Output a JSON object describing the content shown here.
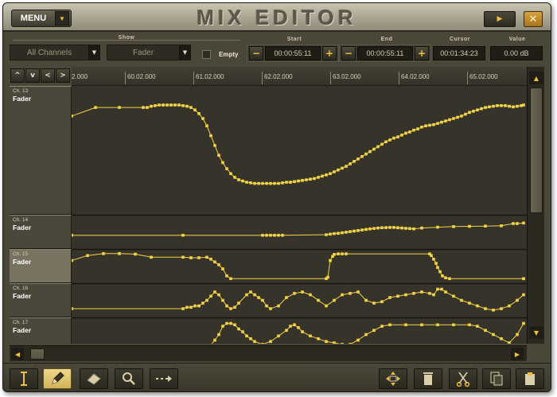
{
  "window": {
    "title": "MIX EDITOR"
  },
  "titlebar": {
    "menu_label": "MENU"
  },
  "controls": {
    "show_label": "Show",
    "channel_filter": "All Channels",
    "parameter_filter": "Fader",
    "empty_label": "Empty",
    "start_label": "Start",
    "start_value": "00:00:55:11",
    "end_label": "End",
    "end_value": "00:00:55:11",
    "cursor_label": "Cursor",
    "cursor_value": "00:01:34:23",
    "value_label": "Value",
    "value_value": "0.00 dB"
  },
  "ruler": {
    "ticks": [
      "2.000",
      "60.02.000",
      "61.02.000",
      "62.02.000",
      "63.02.000",
      "64.02.000",
      "65.02.000"
    ]
  },
  "lanes": [
    {
      "channel": "Ch. 13",
      "param": "Fader",
      "selected": false
    },
    {
      "channel": "Ch. 14",
      "param": "Fader",
      "selected": false
    },
    {
      "channel": "Ch. 15",
      "param": "Fader",
      "selected": true
    },
    {
      "channel": "Ch. 16",
      "param": "Fader",
      "selected": false
    },
    {
      "channel": "Ch. 17",
      "param": "Fader",
      "selected": false
    }
  ],
  "curves": [
    [
      [
        0,
        0.22
      ],
      [
        30,
        0.15
      ],
      [
        60,
        0.15
      ],
      [
        90,
        0.15
      ],
      [
        95,
        0.15
      ],
      [
        100,
        0.14
      ],
      [
        105,
        0.135
      ],
      [
        110,
        0.13
      ],
      [
        115,
        0.13
      ],
      [
        120,
        0.13
      ],
      [
        125,
        0.13
      ],
      [
        130,
        0.13
      ],
      [
        135,
        0.13
      ],
      [
        140,
        0.135
      ],
      [
        145,
        0.14
      ],
      [
        150,
        0.15
      ],
      [
        155,
        0.17
      ],
      [
        160,
        0.2
      ],
      [
        165,
        0.24
      ],
      [
        170,
        0.3
      ],
      [
        175,
        0.38
      ],
      [
        180,
        0.46
      ],
      [
        185,
        0.54
      ],
      [
        190,
        0.6
      ],
      [
        195,
        0.65
      ],
      [
        200,
        0.69
      ],
      [
        205,
        0.72
      ],
      [
        210,
        0.74
      ],
      [
        215,
        0.75
      ],
      [
        220,
        0.76
      ],
      [
        225,
        0.765
      ],
      [
        230,
        0.77
      ],
      [
        235,
        0.77
      ],
      [
        240,
        0.77
      ],
      [
        245,
        0.77
      ],
      [
        250,
        0.77
      ],
      [
        255,
        0.77
      ],
      [
        260,
        0.77
      ],
      [
        265,
        0.765
      ],
      [
        270,
        0.76
      ],
      [
        275,
        0.76
      ],
      [
        280,
        0.755
      ],
      [
        285,
        0.75
      ],
      [
        290,
        0.745
      ],
      [
        295,
        0.74
      ],
      [
        300,
        0.735
      ],
      [
        305,
        0.73
      ],
      [
        310,
        0.72
      ],
      [
        315,
        0.71
      ],
      [
        320,
        0.7
      ],
      [
        325,
        0.69
      ],
      [
        330,
        0.675
      ],
      [
        335,
        0.66
      ],
      [
        340,
        0.645
      ],
      [
        345,
        0.63
      ],
      [
        350,
        0.61
      ],
      [
        355,
        0.59
      ],
      [
        360,
        0.57
      ],
      [
        365,
        0.55
      ],
      [
        370,
        0.53
      ],
      [
        375,
        0.51
      ],
      [
        380,
        0.49
      ],
      [
        385,
        0.47
      ],
      [
        390,
        0.45
      ],
      [
        395,
        0.43
      ],
      [
        400,
        0.415
      ],
      [
        405,
        0.4
      ],
      [
        410,
        0.39
      ],
      [
        415,
        0.375
      ],
      [
        420,
        0.36
      ],
      [
        425,
        0.35
      ],
      [
        430,
        0.335
      ],
      [
        435,
        0.325
      ],
      [
        440,
        0.31
      ],
      [
        445,
        0.3
      ],
      [
        450,
        0.295
      ],
      [
        455,
        0.29
      ],
      [
        460,
        0.28
      ],
      [
        465,
        0.27
      ],
      [
        470,
        0.26
      ],
      [
        475,
        0.25
      ],
      [
        480,
        0.24
      ],
      [
        485,
        0.23
      ],
      [
        490,
        0.22
      ],
      [
        495,
        0.205
      ],
      [
        500,
        0.19
      ],
      [
        505,
        0.18
      ],
      [
        510,
        0.17
      ],
      [
        515,
        0.16
      ],
      [
        520,
        0.15
      ],
      [
        525,
        0.145
      ],
      [
        530,
        0.14
      ],
      [
        535,
        0.135
      ],
      [
        540,
        0.135
      ],
      [
        545,
        0.135
      ],
      [
        550,
        0.14
      ],
      [
        555,
        0.145
      ],
      [
        560,
        0.14
      ],
      [
        565,
        0.135
      ],
      [
        568,
        0.13
      ]
    ],
    [
      [
        0,
        0.62
      ],
      [
        140,
        0.62
      ],
      [
        240,
        0.62
      ],
      [
        245,
        0.62
      ],
      [
        250,
        0.62
      ],
      [
        255,
        0.62
      ],
      [
        260,
        0.62
      ],
      [
        265,
        0.62
      ],
      [
        320,
        0.6
      ],
      [
        325,
        0.58
      ],
      [
        330,
        0.56
      ],
      [
        335,
        0.55
      ],
      [
        340,
        0.53
      ],
      [
        345,
        0.51
      ],
      [
        350,
        0.49
      ],
      [
        355,
        0.47
      ],
      [
        360,
        0.45
      ],
      [
        365,
        0.43
      ],
      [
        370,
        0.41
      ],
      [
        375,
        0.39
      ],
      [
        380,
        0.375
      ],
      [
        385,
        0.36
      ],
      [
        390,
        0.35
      ],
      [
        395,
        0.345
      ],
      [
        400,
        0.34
      ],
      [
        405,
        0.34
      ],
      [
        410,
        0.35
      ],
      [
        415,
        0.36
      ],
      [
        420,
        0.37
      ],
      [
        425,
        0.38
      ],
      [
        430,
        0.39
      ],
      [
        440,
        0.36
      ],
      [
        460,
        0.33
      ],
      [
        480,
        0.31
      ],
      [
        500,
        0.3
      ],
      [
        520,
        0.29
      ],
      [
        540,
        0.28
      ],
      [
        555,
        0.2
      ],
      [
        560,
        0.2
      ],
      [
        568,
        0.18
      ]
    ],
    [
      [
        0,
        0.3
      ],
      [
        20,
        0.12
      ],
      [
        40,
        0.05
      ],
      [
        60,
        0.05
      ],
      [
        80,
        0.07
      ],
      [
        100,
        0.18
      ],
      [
        140,
        0.18
      ],
      [
        150,
        0.2
      ],
      [
        160,
        0.2
      ],
      [
        170,
        0.18
      ],
      [
        175,
        0.25
      ],
      [
        180,
        0.35
      ],
      [
        185,
        0.45
      ],
      [
        190,
        0.6
      ],
      [
        195,
        0.85
      ],
      [
        200,
        0.95
      ],
      [
        320,
        0.95
      ],
      [
        322,
        0.9
      ],
      [
        325,
        0.3
      ],
      [
        328,
        0.15
      ],
      [
        330,
        0.08
      ],
      [
        335,
        0.06
      ],
      [
        340,
        0.06
      ],
      [
        345,
        0.06
      ],
      [
        450,
        0.06
      ],
      [
        452,
        0.12
      ],
      [
        455,
        0.25
      ],
      [
        458,
        0.4
      ],
      [
        460,
        0.55
      ],
      [
        463,
        0.7
      ],
      [
        466,
        0.85
      ],
      [
        470,
        0.92
      ],
      [
        475,
        0.95
      ],
      [
        568,
        0.95
      ]
    ],
    [
      [
        0,
        0.8
      ],
      [
        140,
        0.8
      ],
      [
        145,
        0.75
      ],
      [
        150,
        0.75
      ],
      [
        155,
        0.7
      ],
      [
        160,
        0.7
      ],
      [
        165,
        0.6
      ],
      [
        170,
        0.5
      ],
      [
        175,
        0.35
      ],
      [
        180,
        0.2
      ],
      [
        185,
        0.3
      ],
      [
        190,
        0.5
      ],
      [
        195,
        0.7
      ],
      [
        200,
        0.8
      ],
      [
        205,
        0.75
      ],
      [
        210,
        0.6
      ],
      [
        220,
        0.3
      ],
      [
        225,
        0.2
      ],
      [
        230,
        0.3
      ],
      [
        235,
        0.4
      ],
      [
        240,
        0.5
      ],
      [
        245,
        0.7
      ],
      [
        250,
        0.8
      ],
      [
        260,
        0.7
      ],
      [
        270,
        0.4
      ],
      [
        280,
        0.25
      ],
      [
        290,
        0.2
      ],
      [
        300,
        0.3
      ],
      [
        310,
        0.5
      ],
      [
        320,
        0.7
      ],
      [
        330,
        0.5
      ],
      [
        340,
        0.3
      ],
      [
        350,
        0.25
      ],
      [
        360,
        0.2
      ],
      [
        370,
        0.5
      ],
      [
        380,
        0.6
      ],
      [
        390,
        0.55
      ],
      [
        400,
        0.4
      ],
      [
        410,
        0.35
      ],
      [
        420,
        0.3
      ],
      [
        430,
        0.25
      ],
      [
        440,
        0.2
      ],
      [
        450,
        0.25
      ],
      [
        455,
        0.3
      ],
      [
        460,
        0.1
      ],
      [
        465,
        0.1
      ],
      [
        470,
        0.2
      ],
      [
        480,
        0.35
      ],
      [
        490,
        0.5
      ],
      [
        500,
        0.6
      ],
      [
        510,
        0.7
      ],
      [
        520,
        0.8
      ],
      [
        530,
        0.85
      ],
      [
        540,
        0.8
      ],
      [
        550,
        0.7
      ],
      [
        560,
        0.5
      ],
      [
        568,
        0.3
      ]
    ],
    [
      [
        0,
        1.1
      ],
      [
        170,
        1.05
      ],
      [
        180,
        0.7
      ],
      [
        185,
        0.5
      ],
      [
        190,
        0.2
      ],
      [
        195,
        0.1
      ],
      [
        200,
        0.1
      ],
      [
        205,
        0.15
      ],
      [
        210,
        0.3
      ],
      [
        215,
        0.4
      ],
      [
        220,
        0.55
      ],
      [
        225,
        0.65
      ],
      [
        230,
        0.75
      ],
      [
        240,
        0.85
      ],
      [
        250,
        0.75
      ],
      [
        260,
        0.55
      ],
      [
        270,
        0.35
      ],
      [
        275,
        0.2
      ],
      [
        280,
        0.15
      ],
      [
        285,
        0.25
      ],
      [
        290,
        0.4
      ],
      [
        300,
        0.55
      ],
      [
        310,
        0.65
      ],
      [
        320,
        0.75
      ],
      [
        330,
        0.8
      ],
      [
        340,
        0.85
      ],
      [
        350,
        0.85
      ],
      [
        360,
        0.7
      ],
      [
        370,
        0.5
      ],
      [
        380,
        0.35
      ],
      [
        390,
        0.2
      ],
      [
        400,
        0.15
      ],
      [
        420,
        0.15
      ],
      [
        440,
        0.15
      ],
      [
        460,
        0.15
      ],
      [
        480,
        0.15
      ],
      [
        500,
        0.15
      ],
      [
        510,
        0.2
      ],
      [
        520,
        0.35
      ],
      [
        530,
        0.5
      ],
      [
        540,
        0.65
      ],
      [
        550,
        0.8
      ],
      [
        560,
        0.5
      ],
      [
        568,
        0.1
      ]
    ]
  ],
  "accent_color": "#f3d447",
  "tools": [
    "text-cursor-icon",
    "pencil-icon",
    "eraser-icon",
    "magnifier-icon",
    "arrow-move-icon",
    "four-way-arrow-icon",
    "trash-icon",
    "scissors-icon",
    "copy-icon",
    "paste-icon"
  ]
}
